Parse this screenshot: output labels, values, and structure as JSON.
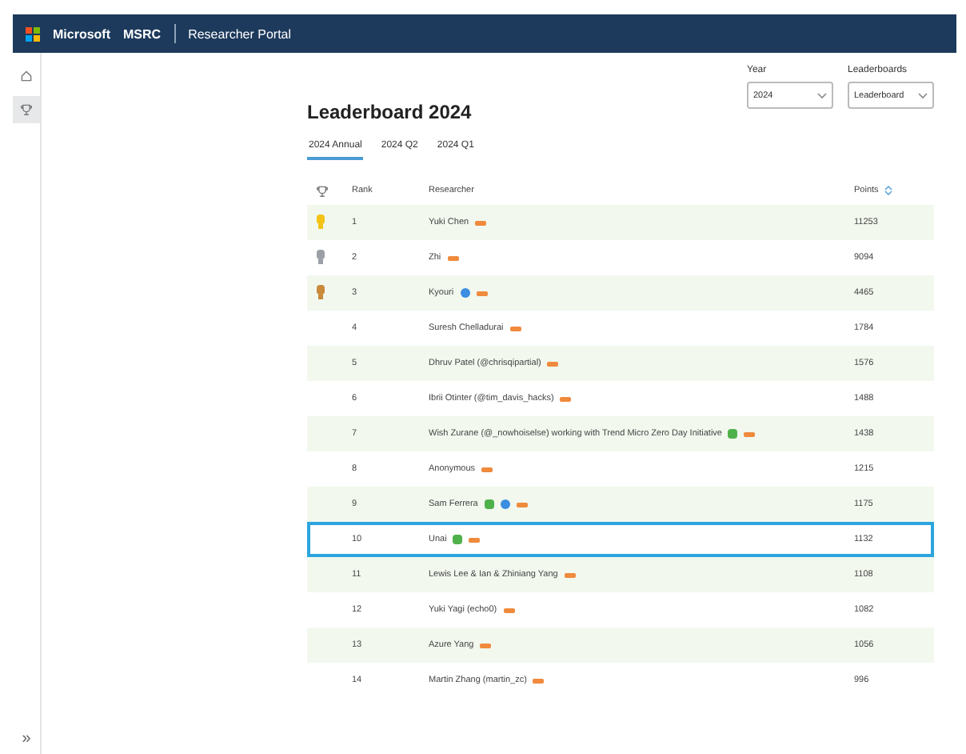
{
  "header": {
    "brand": "Microsoft",
    "product": "MSRC",
    "portal": "Researcher Portal"
  },
  "rail": {
    "items": [
      {
        "kind": "home",
        "selected": false
      },
      {
        "kind": "trophy",
        "selected": true
      }
    ],
    "expand": "»"
  },
  "title": "Leaderboard 2024",
  "filters": [
    {
      "label": "Year",
      "value": "2024"
    },
    {
      "label": "Leaderboards",
      "value": "Leaderboard"
    }
  ],
  "tabs": [
    {
      "label": "2024 Annual",
      "selected": true
    },
    {
      "label": "2024 Q2",
      "selected": false
    },
    {
      "label": "2024 Q1",
      "selected": false
    }
  ],
  "table": {
    "columns": [
      "Rank",
      "Researcher",
      "Points"
    ],
    "rows": [
      {
        "medal": {
          "kind": "gold"
        },
        "rank": "1",
        "researcher": "Yuki Chen",
        "badges": [
          {
            "kind": "trend"
          }
        ],
        "points": "11253",
        "selected": false
      },
      {
        "medal": {
          "kind": "silver"
        },
        "rank": "2",
        "researcher": "Zhi",
        "badges": [
          {
            "kind": "trend"
          }
        ],
        "points": "9094",
        "selected": false
      },
      {
        "medal": {
          "kind": "bronze"
        },
        "rank": "3",
        "researcher": "Kyouri",
        "badges": [
          {
            "kind": "blue"
          },
          {
            "kind": "trend"
          }
        ],
        "points": "4465",
        "selected": false
      },
      {
        "rank": "4",
        "researcher": "Suresh Chelladurai",
        "badges": [
          {
            "kind": "trend"
          }
        ],
        "points": "1784",
        "selected": false
      },
      {
        "rank": "5",
        "researcher": "Dhruv Patel (@chrisqipartial)",
        "badges": [
          {
            "kind": "trend"
          }
        ],
        "points": "1576",
        "selected": false
      },
      {
        "rank": "6",
        "researcher": "Ibrii Otinter (@tim_davis_hacks)",
        "badges": [
          {
            "kind": "trend"
          }
        ],
        "points": "1488",
        "selected": false
      },
      {
        "rank": "7",
        "researcher": "Wish Zurane (@_nowhoiselse) working with Trend Micro Zero Day Initiative",
        "badges": [
          {
            "kind": "green"
          },
          {
            "kind": "trend"
          }
        ],
        "points": "1438",
        "selected": false
      },
      {
        "rank": "8",
        "researcher": "Anonymous",
        "badges": [
          {
            "kind": "trend"
          }
        ],
        "points": "1215",
        "selected": false
      },
      {
        "rank": "9",
        "researcher": "Sam Ferrera",
        "badges": [
          {
            "kind": "green"
          },
          {
            "kind": "blue"
          },
          {
            "kind": "trend"
          }
        ],
        "points": "1175",
        "selected": false
      },
      {
        "rank": "10",
        "researcher": "Unai",
        "badges": [
          {
            "kind": "green"
          },
          {
            "kind": "trend"
          }
        ],
        "points": "1132",
        "selected": true
      },
      {
        "rank": "11",
        "researcher": "Lewis Lee & Ian & Zhiniang Yang",
        "badges": [
          {
            "kind": "trend"
          }
        ],
        "points": "1108",
        "selected": false
      },
      {
        "rank": "12",
        "researcher": "Yuki Yagi (echo0)",
        "badges": [
          {
            "kind": "trend"
          }
        ],
        "points": "1082",
        "selected": false
      },
      {
        "rank": "13",
        "researcher": "Azure Yang",
        "badges": [
          {
            "kind": "trend"
          }
        ],
        "points": "1056",
        "selected": false
      },
      {
        "rank": "14",
        "researcher": "Martin Zhang (martin_zc)",
        "badges": [
          {
            "kind": "trend"
          }
        ],
        "points": "996",
        "selected": false
      }
    ]
  }
}
